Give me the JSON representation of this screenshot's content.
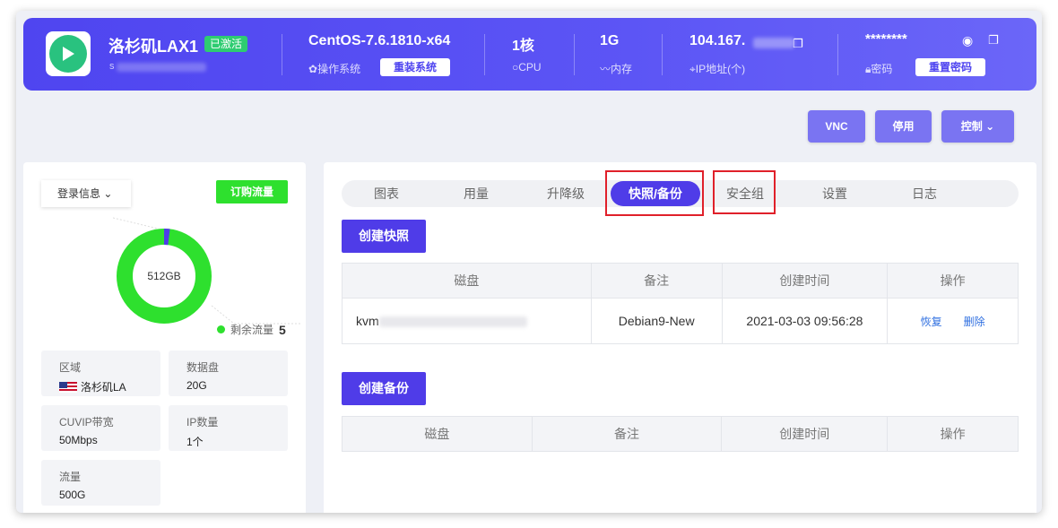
{
  "header": {
    "server_name": "洛杉矶LAX1",
    "status_badge": "已激活",
    "host_prefix": "s",
    "os": "CentOS-7.6.1810-x64",
    "os_label": "操作系统",
    "reinstall_button": "重装系统",
    "cpu_value": "1核",
    "cpu_label": "CPU",
    "memory_value": "1G",
    "memory_label": "内存",
    "ip_value": "104.167.",
    "ip_label": "IP地址(个)",
    "password_value": "********",
    "password_label": "密码",
    "reset_password_button": "重置密码"
  },
  "actions": {
    "vnc": "VNC",
    "stop": "停用",
    "control": "控制"
  },
  "left": {
    "login_info": "登录信息",
    "buy_traffic": "订购流量",
    "donut_center": "512GB",
    "legend_label": "剩余流量",
    "legend_value": "5",
    "usage": {
      "used_fraction": 0.02,
      "remaining_fraction": 0.98
    },
    "specs": [
      {
        "label": "区域",
        "value": "洛杉矶LA"
      },
      {
        "label": "数据盘",
        "value": "20G"
      },
      {
        "label": "CUVIP带宽",
        "value": "50Mbps"
      },
      {
        "label": "IP数量",
        "value": "1个"
      },
      {
        "label": "流量",
        "value": "500G"
      }
    ]
  },
  "tabs": [
    "图表",
    "用量",
    "升降级",
    "快照/备份",
    "安全组",
    "设置",
    "日志"
  ],
  "active_tab": "快照/备份",
  "snapshot": {
    "create_button": "创建快照",
    "columns": [
      "磁盘",
      "备注",
      "创建时间",
      "操作"
    ],
    "rows": [
      {
        "disk": "kvm",
        "note": "Debian9-New",
        "created": "2021-03-03 09:56:28",
        "restore": "恢复",
        "delete": "删除"
      }
    ]
  },
  "backup": {
    "create_button": "创建备份",
    "columns": [
      "磁盘",
      "备注",
      "创建时间",
      "操作"
    ]
  },
  "colors": {
    "accent": "#4f3ce8",
    "banner": "#5c55f5",
    "success": "#2ee02e",
    "highlight": "#e0202a"
  }
}
